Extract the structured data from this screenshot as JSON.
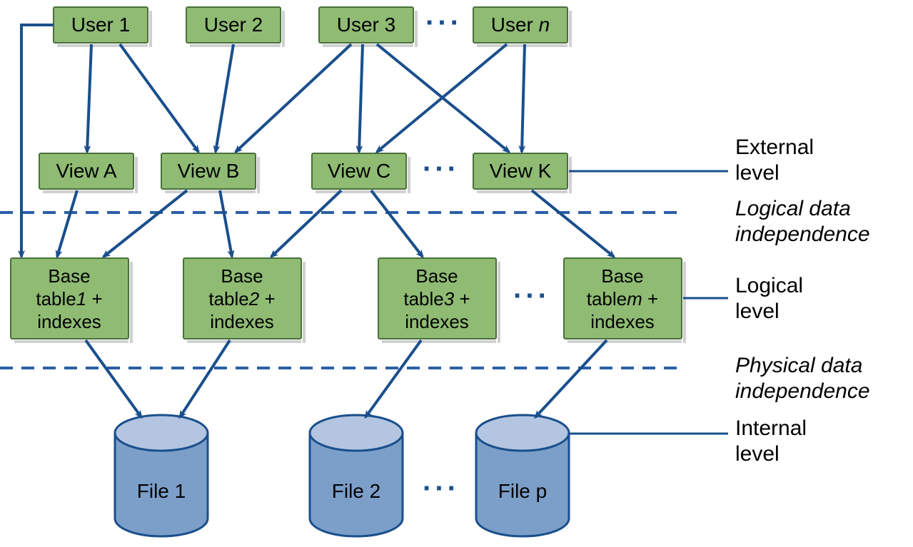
{
  "users": [
    {
      "label": "User 1"
    },
    {
      "label": "User 2"
    },
    {
      "label": "User 3"
    },
    {
      "label": "User n",
      "label_html": "User <tspan font-style='italic'>n</tspan>"
    }
  ],
  "views": [
    {
      "label": "View A"
    },
    {
      "label": "View B"
    },
    {
      "label": "View C"
    },
    {
      "label": "View K"
    }
  ],
  "tables": [
    {
      "line1": "Base",
      "line2": "table1 +",
      "line2_html": "table<tspan font-style='italic'>1</tspan> +",
      "line3": "indexes"
    },
    {
      "line1": "Base",
      "line2": "table2 +",
      "line2_html": "table<tspan font-style='italic'>2</tspan> +",
      "line3": "indexes"
    },
    {
      "line1": "Base",
      "line2": "table3 +",
      "line2_html": "table<tspan font-style='italic'>3</tspan> +",
      "line3": "indexes"
    },
    {
      "line1": "Base",
      "line2": "tablem +",
      "line2_html": "table<tspan font-style='italic'>m</tspan> +",
      "line3": "indexes"
    }
  ],
  "files": [
    {
      "label": "File 1"
    },
    {
      "label": "File 2"
    },
    {
      "label": "File p"
    }
  ],
  "labels": {
    "external_level_1": "External",
    "external_level_2": "level",
    "logical_independence_1": "Logical data",
    "logical_independence_2": "independence",
    "logical_level_1": "Logical",
    "logical_level_2": "level",
    "physical_independence_1": "Physical data",
    "physical_independence_2": "independence",
    "internal_level_1": "Internal",
    "internal_level_2": "level"
  },
  "colors": {
    "box_fill": "#8fbb73",
    "box_stroke": "#49713a",
    "cyl_top_fill": "#b3c5e0",
    "cyl_body_fill": "#7c9fc9",
    "cyl_stroke": "#1a4f8c",
    "arrow": "#1a4f8c",
    "dashed": "#2c5fa6"
  }
}
